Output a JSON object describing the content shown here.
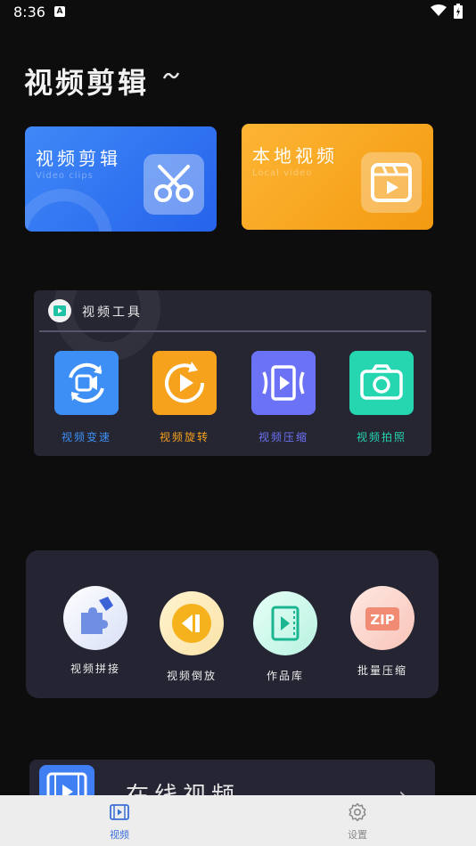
{
  "status_bar": {
    "time": "8:36",
    "notification_badge": "A"
  },
  "page": {
    "title": "视频剪辑"
  },
  "cards": [
    {
      "title": "视频剪辑",
      "subtitle": "Video clips",
      "icon": "scissors-icon",
      "color": "#3b82f6"
    },
    {
      "title": "本地视频",
      "subtitle": "Local video",
      "icon": "film-play-icon",
      "color": "#f9a825"
    }
  ],
  "tools_panel": {
    "title": "视频工具",
    "items": [
      {
        "label": "视频变速",
        "icon": "speed-camera-icon",
        "color": "#3d8ff5"
      },
      {
        "label": "视频旋转",
        "icon": "rotate-play-icon",
        "color": "#f6a21c"
      },
      {
        "label": "视频压缩",
        "icon": "compress-play-icon",
        "color": "#6c72f5"
      },
      {
        "label": "视频拍照",
        "icon": "camera-icon",
        "color": "#25d6b0"
      }
    ]
  },
  "more_tools": {
    "items": [
      {
        "label": "视频拼接",
        "icon": "puzzle-icon",
        "color": "#5b7fe8"
      },
      {
        "label": "视频倒放",
        "icon": "rewind-icon",
        "color": "#f5b21c"
      },
      {
        "label": "作品库",
        "icon": "film-library-icon",
        "color": "#22c8a4"
      },
      {
        "label": "批量压缩",
        "icon": "zip-icon",
        "color": "#f28b74"
      }
    ]
  },
  "online": {
    "title": "在线视频",
    "arrow": "›"
  },
  "tabbar": {
    "tabs": [
      {
        "label": "视频",
        "icon": "video-tab-icon",
        "active": true,
        "color": "#3b6fd8"
      },
      {
        "label": "设置",
        "icon": "settings-gear-icon",
        "active": false,
        "color": "#8a8a8a"
      }
    ]
  }
}
